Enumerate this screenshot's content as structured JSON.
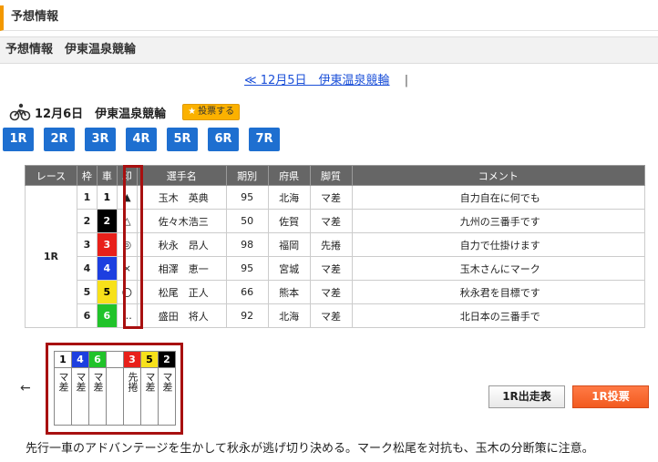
{
  "header": {
    "title": "予想情報"
  },
  "subheader": {
    "title": "予想情報　伊東温泉競輪"
  },
  "day_nav": {
    "prev_label": "≪ 12月5日　伊東温泉競輪",
    "separator": "|"
  },
  "race_title": {
    "text": "12月6日　伊東温泉競輪",
    "vote_label": "投票する"
  },
  "race_tabs": [
    "1R",
    "2R",
    "3R",
    "4R",
    "5R",
    "6R",
    "7R"
  ],
  "table": {
    "headers": [
      "レース",
      "枠",
      "車",
      "印",
      "選手名",
      "期別",
      "府県",
      "脚質",
      "コメント"
    ],
    "race": "1R",
    "rows": [
      {
        "frame": "1",
        "car": "1",
        "mark": "▲",
        "name": "玉木　英典",
        "term": "95",
        "pref": "北海",
        "style": "マ差",
        "comment": "自力自在に何でも",
        "color": "#ffffff",
        "text": "#000000"
      },
      {
        "frame": "2",
        "car": "2",
        "mark": "△",
        "name": "佐々木浩三",
        "term": "50",
        "pref": "佐賀",
        "style": "マ差",
        "comment": "九州の三番手です",
        "color": "#000000",
        "text": "#ffffff"
      },
      {
        "frame": "3",
        "car": "3",
        "mark": "◎",
        "name": "秋永　昂人",
        "term": "98",
        "pref": "福岡",
        "style": "先捲",
        "comment": "自力で仕掛けます",
        "color": "#e8201a",
        "text": "#ffffff"
      },
      {
        "frame": "4",
        "car": "4",
        "mark": "×",
        "name": "相澤　恵一",
        "term": "95",
        "pref": "宮城",
        "style": "マ差",
        "comment": "玉木さんにマーク",
        "color": "#1d3fe0",
        "text": "#ffffff"
      },
      {
        "frame": "5",
        "car": "5",
        "mark": "〇",
        "name": "松尾　正人",
        "term": "66",
        "pref": "熊本",
        "style": "マ差",
        "comment": "秋永君を目標です",
        "color": "#f7e11a",
        "text": "#000000"
      },
      {
        "frame": "6",
        "car": "6",
        "mark": "…",
        "name": "盛田　将人",
        "term": "92",
        "pref": "北海",
        "style": "マ差",
        "comment": "北日本の三番手で",
        "color": "#21c32a",
        "text": "#ffffff"
      }
    ]
  },
  "line_prediction": {
    "arrow": "←",
    "columns": [
      {
        "num": "1",
        "label": "マ差",
        "color": "#ffffff",
        "text": "#000000"
      },
      {
        "num": "4",
        "label": "マ差",
        "color": "#1d3fe0",
        "text": "#ffffff"
      },
      {
        "num": "6",
        "label": "マ差",
        "color": "#21c32a",
        "text": "#ffffff"
      },
      {
        "num": "",
        "label": "",
        "color": "#ffffff",
        "text": "#000000"
      },
      {
        "num": "3",
        "label": "先捲",
        "color": "#e8201a",
        "text": "#ffffff"
      },
      {
        "num": "5",
        "label": "マ差",
        "color": "#f7e11a",
        "text": "#000000"
      },
      {
        "num": "2",
        "label": "マ差",
        "color": "#000000",
        "text": "#ffffff"
      }
    ]
  },
  "buttons": {
    "entry_label": "1R出走表",
    "vote_label": "1R投票"
  },
  "summary": "先行一車のアドバンテージを生かして秋永が逃げ切り決める。マーク松尾を対抗も、玉木の分断策に注意。"
}
